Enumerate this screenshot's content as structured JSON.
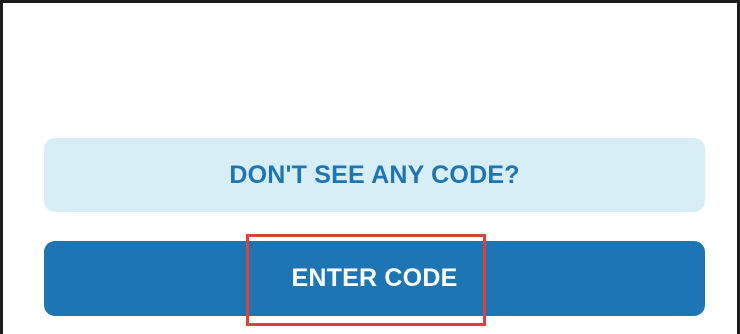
{
  "secondary_button": {
    "label": "DON'T SEE ANY CODE?"
  },
  "primary_button": {
    "label": "ENTER CODE"
  },
  "colors": {
    "primary": "#1d75b3",
    "secondary_bg": "#d8eef6",
    "highlight": "#d9433a",
    "frame": "#1b1b1b"
  }
}
